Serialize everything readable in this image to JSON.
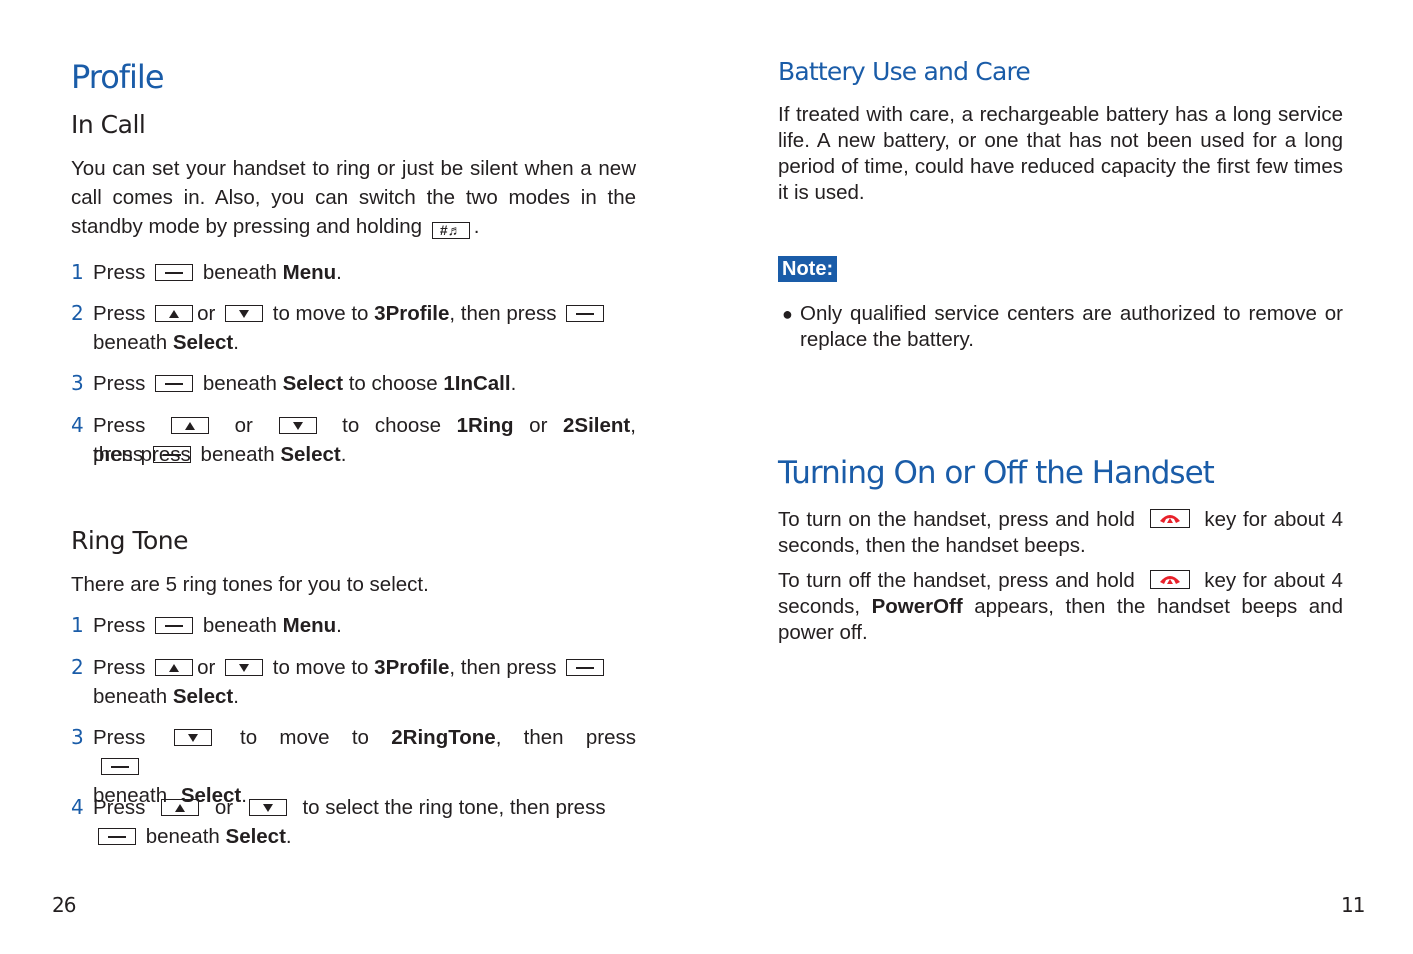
{
  "left_page": {
    "title": "Profile",
    "in_call": {
      "heading": "In Call",
      "intro": "You can set your handset to ring or just be silent when a new call comes in. Also, you can switch the two modes in the standby mode by pressing and holding",
      "intro_end": ".",
      "hash_key_icon": "hash-music-key-icon",
      "steps": [
        {
          "num": "1",
          "a": "Press",
          "b": "beneath",
          "c": "Menu",
          "d": "."
        },
        {
          "num": "2",
          "a": "Press",
          "b": "or",
          "c": "to move to",
          "d": "3Profile",
          "e": ", then press",
          "f": "beneath",
          "g": "Select",
          "h": "."
        },
        {
          "num": "3",
          "a": "Press",
          "b": "beneath",
          "c": "Select",
          "d": "to choose",
          "e": "1InCall",
          "f": "."
        },
        {
          "num": "4",
          "a": "Press",
          "b": "or",
          "c": "to choose",
          "d": "1Ring",
          "e": "or",
          "f": "2Silent",
          "g": ", then press",
          "h": "beneath",
          "i": "Select",
          "j": "."
        }
      ]
    },
    "ring_tone": {
      "heading": "Ring Tone",
      "intro": "There are 5 ring tones for you to select.",
      "steps": [
        {
          "num": "1",
          "a": "Press",
          "b": "beneath",
          "c": "Menu",
          "d": "."
        },
        {
          "num": "2",
          "a": "Press",
          "b": "or",
          "c": "to move to",
          "d": "3Profile",
          "e": ", then press",
          "f": "beneath",
          "g": "Select",
          "h": "."
        },
        {
          "num": "3",
          "a": "Press",
          "b": "to move to",
          "c": "2RingTone",
          "d": ", then press",
          "e": "beneath",
          "f": "Select",
          "g": "."
        },
        {
          "num": "4",
          "a": "Press",
          "b": "or",
          "c": "to select the ring tone, then press",
          "d": "beneath",
          "e": "Select",
          "f": "."
        }
      ]
    },
    "page_number": "26"
  },
  "right_page": {
    "battery": {
      "heading": "Battery Use and Care",
      "body": "If treated with care, a rechargeable battery has a long service life. A new battery, or one that has not been used for a long period of time, could have reduced capacity the first few times it is used.",
      "note_label": "Note:",
      "note_bullet": "Only qualified service centers are authorized to remove or replace the battery."
    },
    "turning": {
      "heading": "Turning On or Off the Handset",
      "on_a": "To turn on the handset, press and hold",
      "on_b": "key for about 4 seconds, then the handset beeps.",
      "off_a": "To turn off the handset, press and hold",
      "off_b": "key for about 4 seconds,",
      "off_bold": "PowerOff",
      "off_c": "appears, then the handset beeps and power off."
    },
    "page_number": "11"
  },
  "colors": {
    "accent": "#1a5ca8",
    "text": "#231f20",
    "end_call": "#e8212a"
  }
}
